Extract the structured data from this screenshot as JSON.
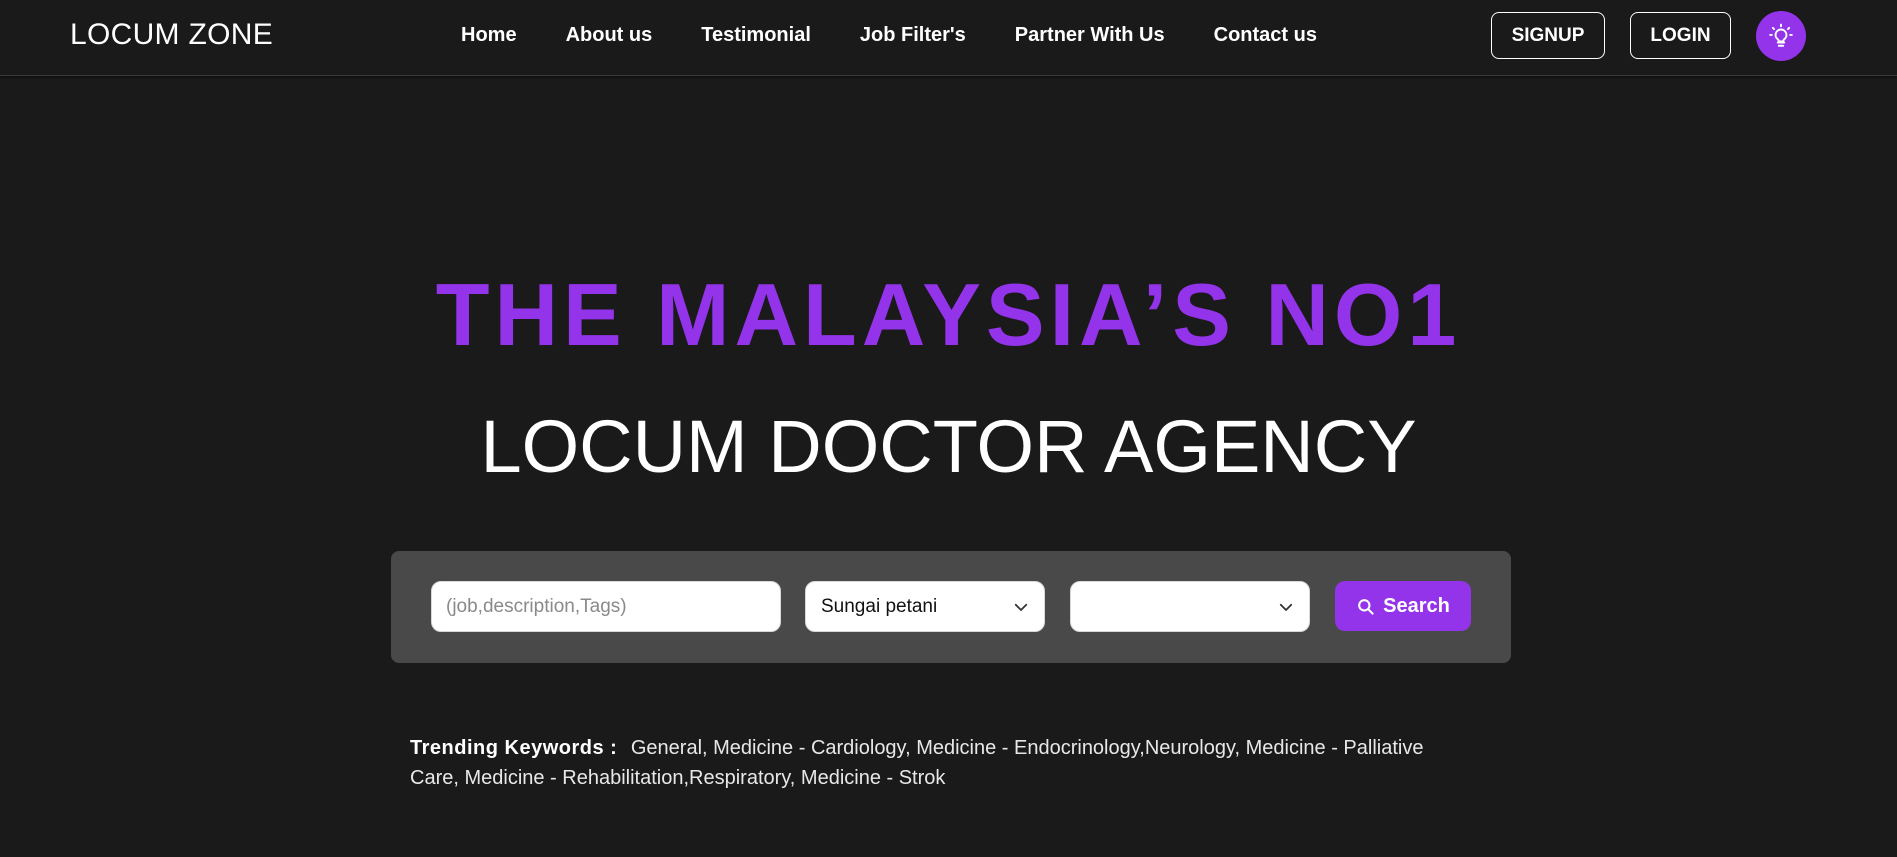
{
  "brand": {
    "name": "LOCUM ZONE"
  },
  "nav": {
    "items": [
      {
        "label": "Home"
      },
      {
        "label": "About us"
      },
      {
        "label": "Testimonial"
      },
      {
        "label": "Job Filter's"
      },
      {
        "label": "Partner With Us"
      },
      {
        "label": "Contact us"
      }
    ],
    "signup_label": "SIGNUP",
    "login_label": "LOGIN",
    "theme_toggle_icon": "lightbulb-icon"
  },
  "hero": {
    "title": "THE MALAYSIA’S NO1",
    "subtitle": "LOCUM DOCTOR AGENCY"
  },
  "search": {
    "keyword_placeholder": "(job,description,Tags)",
    "keyword_value": "",
    "location_value": "Sungai petani",
    "category_value": "",
    "button_label": "Search",
    "button_icon": "search-icon"
  },
  "trending": {
    "label": "Trending Keywords :",
    "keywords": "General, Medicine - Cardiology, Medicine - Endocrinology,Neurology, Medicine - Palliative Care, Medicine - Rehabilitation,Respiratory, Medicine - Strok"
  },
  "colors": {
    "background": "#1b1a1b",
    "accent": "#9333ea",
    "panel": "#4a494a"
  }
}
